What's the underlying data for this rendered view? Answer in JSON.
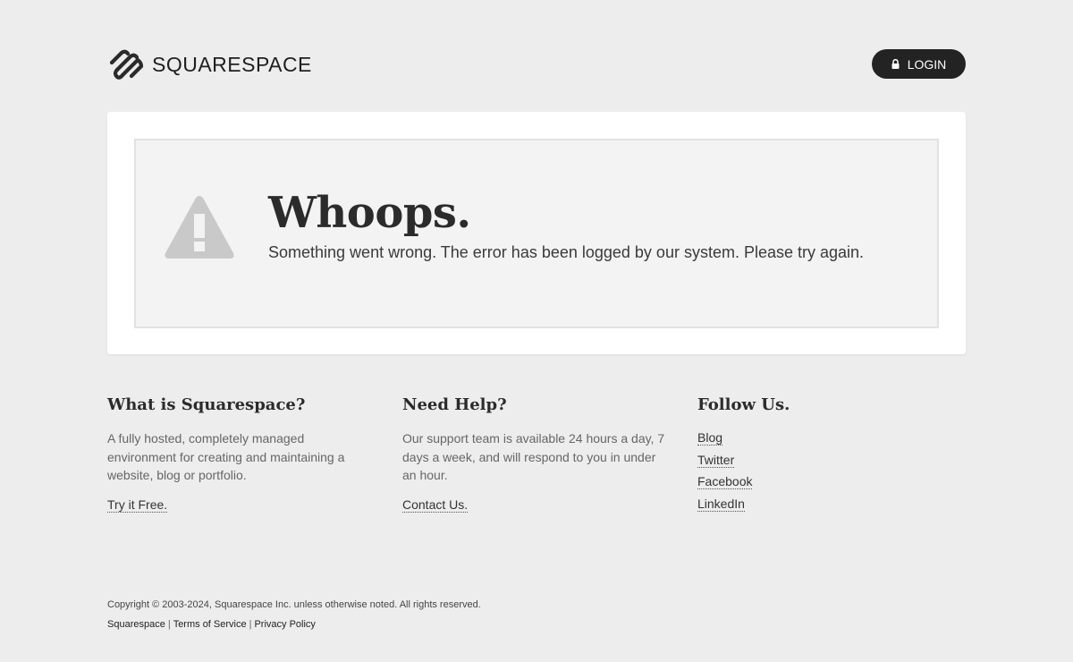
{
  "header": {
    "logo_text": "SQUARESPACE",
    "login_label": "LOGIN"
  },
  "error": {
    "title": "Whoops.",
    "message": "Something went wrong. The error has been logged by our system. Please try again."
  },
  "columns": [
    {
      "heading": "What is Squarespace?",
      "body": "A fully hosted, completely managed environment for creating and maintaining a website, blog or portfolio.",
      "link": "Try it Free."
    },
    {
      "heading": "Need Help?",
      "body": "Our support team is available 24 hours a day, 7 days a week, and will respond to you in under an hour.",
      "link": "Contact Us."
    },
    {
      "heading": "Follow Us.",
      "links": [
        "Blog",
        "Twitter",
        "Facebook",
        "LinkedIn"
      ]
    }
  ],
  "footer": {
    "copyright": "Copyright © 2003-2024, Squarespace Inc. unless otherwise noted. All rights reserved.",
    "links": [
      "Squarespace",
      "Terms of Service",
      "Privacy Policy"
    ],
    "separator": "|"
  },
  "colors": {
    "background": "#ededed",
    "panel": "#ffffff",
    "inner_panel": "#f3f3f3",
    "login_button": "#232323",
    "warning_icon": "#c9c9c9"
  },
  "icons": {
    "logo": "squarespace-logo-icon",
    "lock": "lock-icon",
    "warning": "warning-triangle-icon"
  }
}
